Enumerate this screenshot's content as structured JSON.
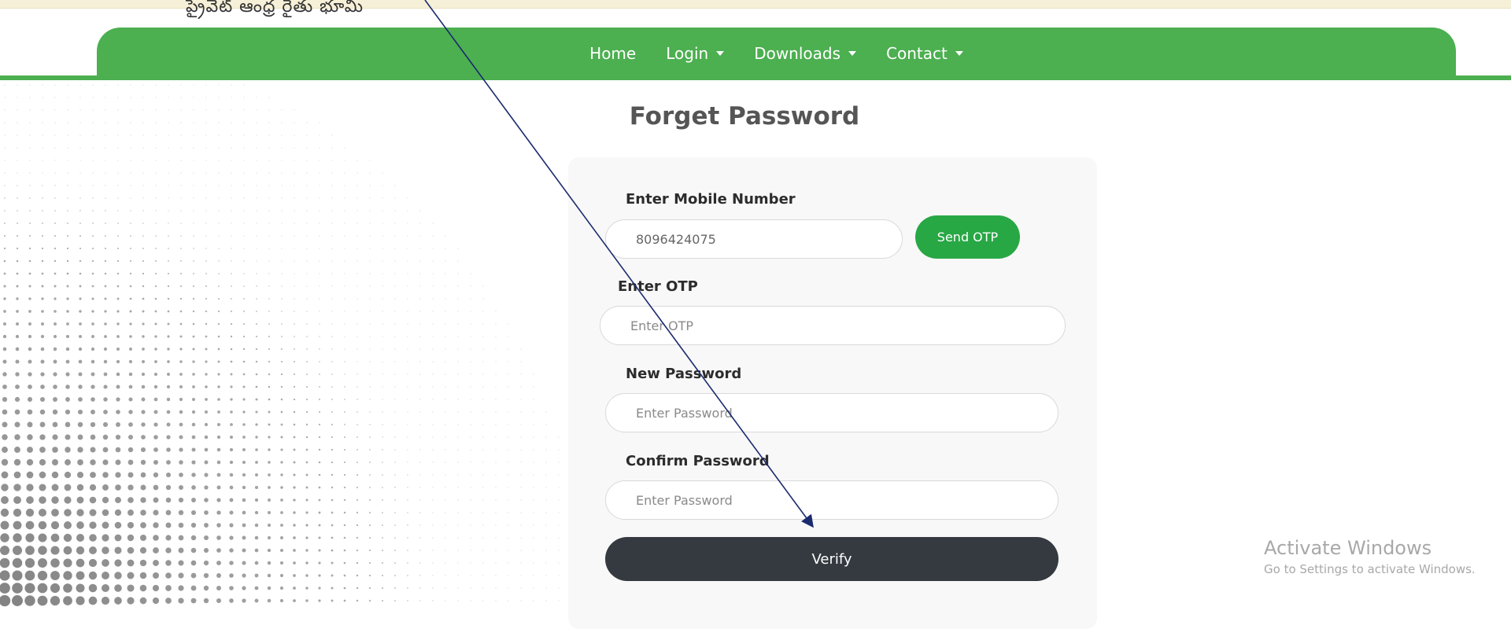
{
  "header": {
    "telugu_text": "ప్రైవేట్ ఆంధ్ర రైతు భూమి"
  },
  "nav": {
    "items": [
      {
        "label": "Home",
        "has_caret": false
      },
      {
        "label": "Login",
        "has_caret": true
      },
      {
        "label": "Downloads",
        "has_caret": true
      },
      {
        "label": "Contact",
        "has_caret": true
      }
    ]
  },
  "form": {
    "title": "Forget Password",
    "mobile": {
      "label": "Enter Mobile Number",
      "value": "8096424075"
    },
    "send_otp_label": "Send OTP",
    "otp": {
      "label": "Enter OTP",
      "placeholder": "Enter OTP"
    },
    "new_password": {
      "label": "New Password",
      "placeholder": "Enter Password"
    },
    "confirm_password": {
      "label": "Confirm Password",
      "placeholder": "Enter Password"
    },
    "verify_label": "Verify"
  },
  "watermark": {
    "title": "Activate Windows",
    "subtitle": "Go to Settings to activate Windows."
  },
  "colors": {
    "nav_green": "#4caf50",
    "send_otp_green": "#28a745",
    "verify_dark": "#343a40"
  },
  "icons": [
    "caret-down-icon",
    "annotation-arrow-icon",
    "halftone-dots-pattern"
  ]
}
